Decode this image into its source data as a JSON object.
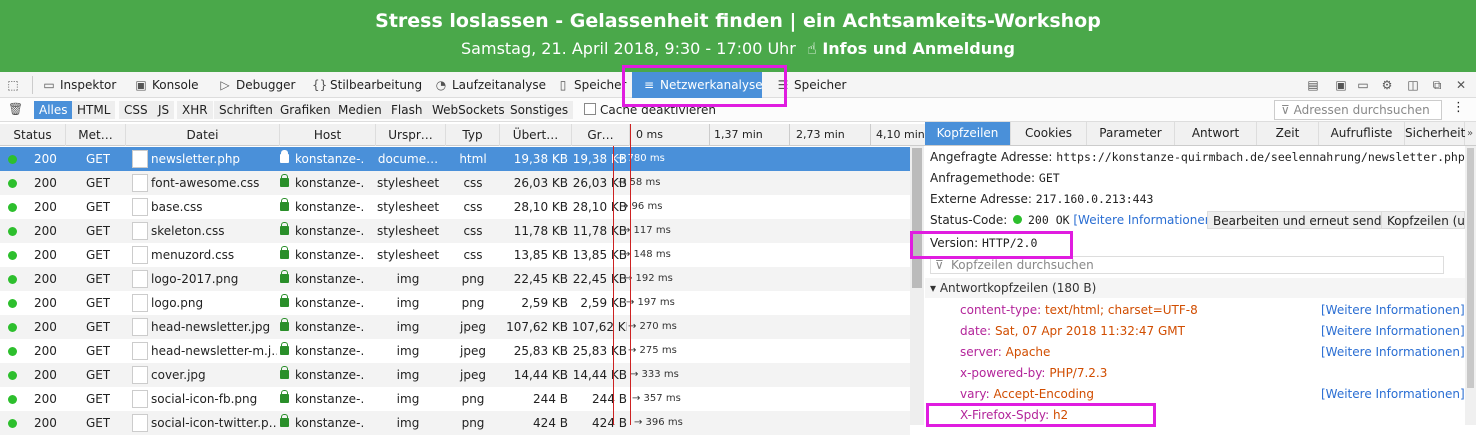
{
  "banner": {
    "title": "Stress loslassen - Gelassenheit finden | ein Achtsamkeits-Workshop",
    "date": "Samstag, 21. April 2018, 9:30 - 17:00 Uhr",
    "link": "Infos und Anmeldung"
  },
  "toolbar": {
    "tabs": [
      "Inspektor",
      "Konsole",
      "Debugger",
      "Stilbearbeitung",
      "Laufzeitanalyse",
      "Speicher",
      "Netzwerkanalyse",
      "Speicher"
    ]
  },
  "filters": {
    "items": [
      "Alles",
      "HTML",
      "CSS",
      "JS",
      "XHR",
      "Schriften",
      "Grafiken",
      "Medien",
      "Flash",
      "WebSockets",
      "Sonstiges"
    ],
    "cache_label": "Cache deaktivieren",
    "search_placeholder": "Adressen durchsuchen"
  },
  "columns": {
    "status": "Status",
    "method": "Met…",
    "file": "Datei",
    "host": "Host",
    "cause": "Urspr…",
    "type": "Typ",
    "transferred": "Übert…",
    "size": "Gr…"
  },
  "waterfall_ticks": [
    "0 ms",
    "1,37 min",
    "2,73 min",
    "4,10 min"
  ],
  "requests": [
    {
      "status": "200",
      "method": "GET",
      "file": "newsletter.php",
      "host": "konstanze-…",
      "cause": "docume…",
      "type": "html",
      "transferred": "19,38 KB",
      "size": "19,38 KB",
      "time": "→ 780 ms"
    },
    {
      "status": "200",
      "method": "GET",
      "file": "font-awesome.css",
      "host": "konstanze-…",
      "cause": "stylesheet",
      "type": "css",
      "transferred": "26,03 KB",
      "size": "26,03 KB",
      "time": "→ 58 ms"
    },
    {
      "status": "200",
      "method": "GET",
      "file": "base.css",
      "host": "konstanze-…",
      "cause": "stylesheet",
      "type": "css",
      "transferred": "28,10 KB",
      "size": "28,10 KB",
      "time": "→ 96 ms"
    },
    {
      "status": "200",
      "method": "GET",
      "file": "skeleton.css",
      "host": "konstanze-…",
      "cause": "stylesheet",
      "type": "css",
      "transferred": "11,78 KB",
      "size": "11,78 KB",
      "time": "→ 117 ms"
    },
    {
      "status": "200",
      "method": "GET",
      "file": "menuzord.css",
      "host": "konstanze-…",
      "cause": "stylesheet",
      "type": "css",
      "transferred": "13,85 KB",
      "size": "13,85 KB",
      "time": "→ 148 ms"
    },
    {
      "status": "200",
      "method": "GET",
      "file": "logo-2017.png",
      "host": "konstanze-…",
      "cause": "img",
      "type": "png",
      "transferred": "22,45 KB",
      "size": "22,45 KB",
      "time": "→ 192 ms"
    },
    {
      "status": "200",
      "method": "GET",
      "file": "logo.png",
      "host": "konstanze-…",
      "cause": "img",
      "type": "png",
      "transferred": "2,59 KB",
      "size": "2,59 KB",
      "time": "→ 197 ms"
    },
    {
      "status": "200",
      "method": "GET",
      "file": "head-newsletter.jpg",
      "host": "konstanze-…",
      "cause": "img",
      "type": "jpeg",
      "transferred": "107,62 KB",
      "size": "107,62 KB",
      "time": "→ 270 ms"
    },
    {
      "status": "200",
      "method": "GET",
      "file": "head-newsletter-m.j…",
      "host": "konstanze-…",
      "cause": "img",
      "type": "jpeg",
      "transferred": "25,83 KB",
      "size": "25,83 KB",
      "time": "→ 275 ms"
    },
    {
      "status": "200",
      "method": "GET",
      "file": "cover.jpg",
      "host": "konstanze-…",
      "cause": "img",
      "type": "jpeg",
      "transferred": "14,44 KB",
      "size": "14,44 KB",
      "time": "→ 333 ms"
    },
    {
      "status": "200",
      "method": "GET",
      "file": "social-icon-fb.png",
      "host": "konstanze-…",
      "cause": "img",
      "type": "png",
      "transferred": "244 B",
      "size": "244 B",
      "time": "→ 357 ms"
    },
    {
      "status": "200",
      "method": "GET",
      "file": "social-icon-twitter.p…",
      "host": "konstanze-…",
      "cause": "img",
      "type": "png",
      "transferred": "424 B",
      "size": "424 B",
      "time": "→ 396 ms"
    }
  ],
  "detail_tabs": [
    "Kopfzeilen",
    "Cookies",
    "Parameter",
    "Antwort",
    "Zeit",
    "Aufrufliste",
    "Sicherheit"
  ],
  "detail": {
    "url_label": "Angefragte Adresse:",
    "url": "https://konstanze-quirmbach.de/seelennahrung/newsletter.php",
    "method_label": "Anfragemethode:",
    "method": "GET",
    "remote_label": "Externe Adresse:",
    "remote": "217.160.0.213:443",
    "status_label": "Status-Code:",
    "status": "200 OK",
    "more_info": "[Weitere Informationen]",
    "edit_resend": "Bearbeiten und erneut senden",
    "headers_btn": "Kopfzeilen (unfo",
    "version_label": "Version:",
    "version": "HTTP/2.0",
    "filter_placeholder": "Kopfzeilen durchsuchen",
    "response_section": "Antwortkopfzeilen (180 B)",
    "response_headers": [
      {
        "name": "content-type:",
        "value": "text/html; charset=UTF-8",
        "info": "[Weitere Informationen]"
      },
      {
        "name": "date:",
        "value": "Sat, 07 Apr 2018 11:32:47 GMT",
        "info": "[Weitere Informationen]"
      },
      {
        "name": "server:",
        "value": "Apache",
        "info": "[Weitere Informationen]"
      },
      {
        "name": "x-powered-by:",
        "value": "PHP/7.2.3",
        "info": ""
      },
      {
        "name": "vary:",
        "value": "Accept-Encoding",
        "info": "[Weitere Informationen]"
      },
      {
        "name": "X-Firefox-Spdy:",
        "value": "h2",
        "info": ""
      }
    ]
  },
  "colors": {
    "accent": "#4a90d9",
    "highlight": "#e01ce0",
    "banner": "#4aa84a"
  }
}
